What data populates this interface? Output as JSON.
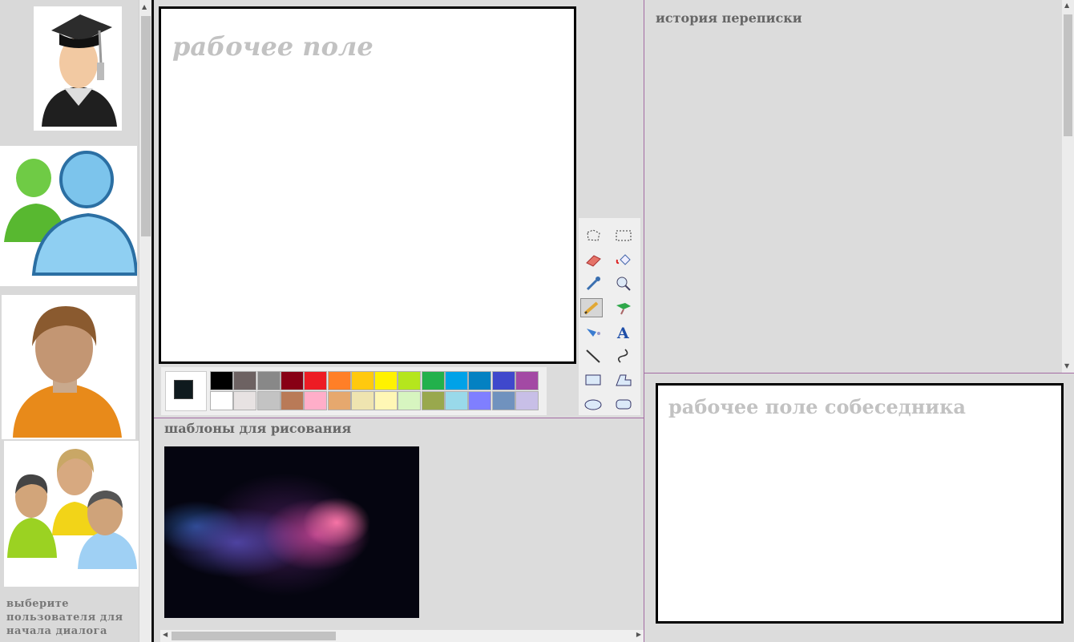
{
  "left_panel": {
    "hint": "выберите пользователя для начала диалога",
    "users": [
      {
        "icon": "graduate-user-icon"
      },
      {
        "icon": "messenger-users-icon"
      },
      {
        "icon": "user-orange-icon"
      },
      {
        "icon": "user-group-icon"
      }
    ]
  },
  "canvas": {
    "title": "рабочее поле"
  },
  "palette": {
    "current_color": "#0f1a1e",
    "row1": [
      "#000000",
      "#6d6262",
      "#888888",
      "#880015",
      "#ed1c24",
      "#ff7f27",
      "#ffc90e",
      "#fff200",
      "#b5e61d",
      "#22b14c",
      "#00a2e8",
      "#0481c2",
      "#3f48cc",
      "#a349a4"
    ],
    "row2": [
      "#ffffff",
      "#e7e2e2",
      "#c3c3c3",
      "#b97a57",
      "#ffaec9",
      "#e6a86e",
      "#efe4b0",
      "#fff7b5",
      "#d7f5c0",
      "#99a84d",
      "#99d9ea",
      "#7f7fff",
      "#7092be",
      "#c8bfe7"
    ]
  },
  "tools": [
    "free-select-icon",
    "rect-select-icon",
    "eraser-icon",
    "fill-icon",
    "color-picker-icon",
    "magnifier-icon",
    "pencil-icon",
    "brush-icon",
    "airbrush-icon",
    "text-icon",
    "line-icon",
    "curve-icon",
    "rectangle-icon",
    "polygon-icon",
    "ellipse-icon",
    "rounded-rect-icon"
  ],
  "templates": {
    "title": "шаблоны для рисования"
  },
  "history": {
    "title": "история переписки"
  },
  "peer_canvas": {
    "title": "рабочее поле собеседника"
  }
}
